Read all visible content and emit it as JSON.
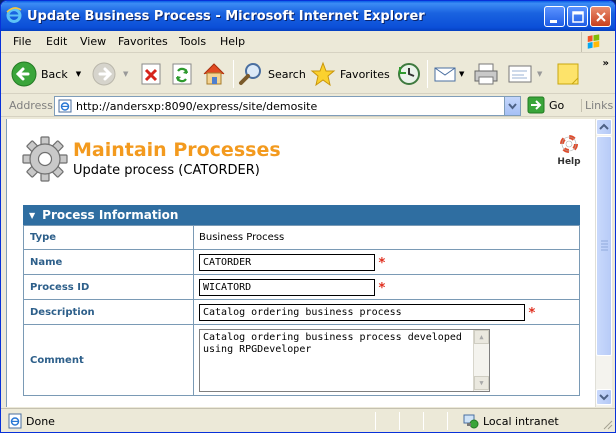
{
  "window": {
    "title": "Update Business Process - Microsoft Internet Explorer"
  },
  "menu": [
    "File",
    "Edit",
    "View",
    "Favorites",
    "Tools",
    "Help"
  ],
  "toolbar": {
    "back_label": "Back",
    "search_label": "Search",
    "favorites_label": "Favorites"
  },
  "address": {
    "label": "Address",
    "url": "http://andersxp:8090/express/site/demosite",
    "go_label": "Go",
    "links_label": "Links"
  },
  "page": {
    "title": "Maintain Processes",
    "subtitle": "Update process (CATORDER)",
    "help_label": "Help"
  },
  "panel": {
    "header": "Process Information",
    "rows": {
      "type": {
        "label": "Type",
        "value": "Business Process"
      },
      "name": {
        "label": "Name",
        "value": "CATORDER",
        "required": "*"
      },
      "process_id": {
        "label": "Process ID",
        "value": "WICATORD",
        "required": "*"
      },
      "description": {
        "label": "Description",
        "value": "Catalog ordering business process",
        "required": "*"
      },
      "comment": {
        "label": "Comment",
        "value": "Catalog ordering business process developed using RPGDeveloper"
      }
    }
  },
  "status": {
    "text": "Done",
    "zone": "Local intranet"
  },
  "colors": {
    "title_orange": "#f39a1e",
    "panel_header": "#2f6ea1",
    "label_blue": "#2d5f8a",
    "required_red": "#e03020"
  }
}
